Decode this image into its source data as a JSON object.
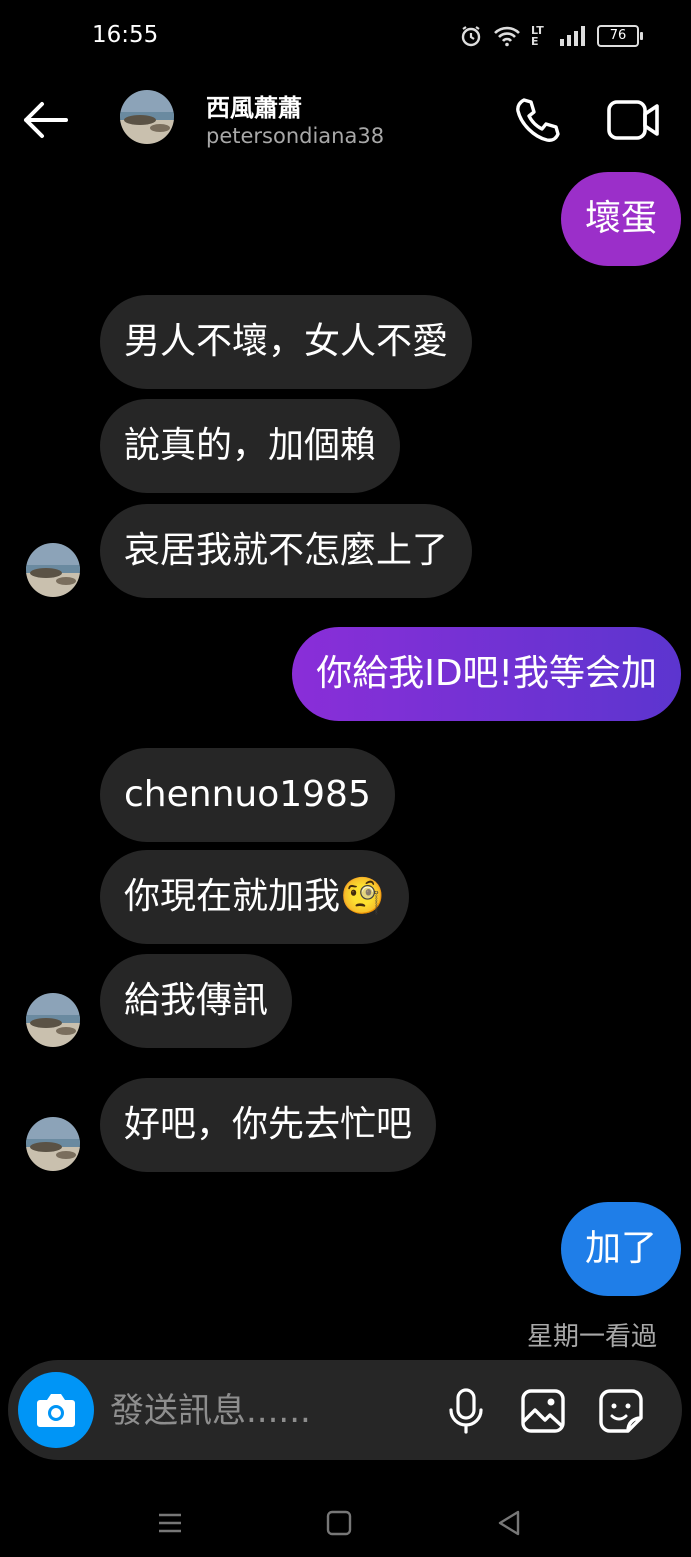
{
  "status": {
    "time": "16:55",
    "battery": "76",
    "network": "LTE"
  },
  "header": {
    "name": "西風蕭蕭",
    "username": "petersondiana38"
  },
  "messages": [
    {
      "text": "壞蛋",
      "dir": "out"
    },
    {
      "text": "男人不壞，女人不愛",
      "dir": "in"
    },
    {
      "text": "說真的，加個賴",
      "dir": "in"
    },
    {
      "text": "哀居我就不怎麼上了",
      "dir": "in"
    },
    {
      "text": "你給我ID吧!我等会加",
      "dir": "out"
    },
    {
      "text": "chennuo1985",
      "dir": "in"
    },
    {
      "text": "你現在就加我",
      "emoji": "🧐",
      "dir": "in"
    },
    {
      "text": "給我傳訊",
      "dir": "in"
    },
    {
      "text": "好吧，你先去忙吧",
      "dir": "in"
    },
    {
      "text": "加了",
      "dir": "out"
    }
  ],
  "seen_text": "星期一看過",
  "composer": {
    "placeholder": "發送訊息......"
  },
  "colors": {
    "incoming_bubble": "#262626",
    "outgoing_purple": "#9b2fc9",
    "outgoing_violet": "#6a35d6",
    "outgoing_blue": "#1f7ee8",
    "accent": "#0095f6"
  },
  "icons": {
    "back": "arrow-left-icon",
    "call": "phone-icon",
    "video": "video-camera-icon",
    "camera": "camera-icon",
    "mic": "microphone-icon",
    "gallery": "image-icon",
    "sticker": "sticker-icon"
  }
}
